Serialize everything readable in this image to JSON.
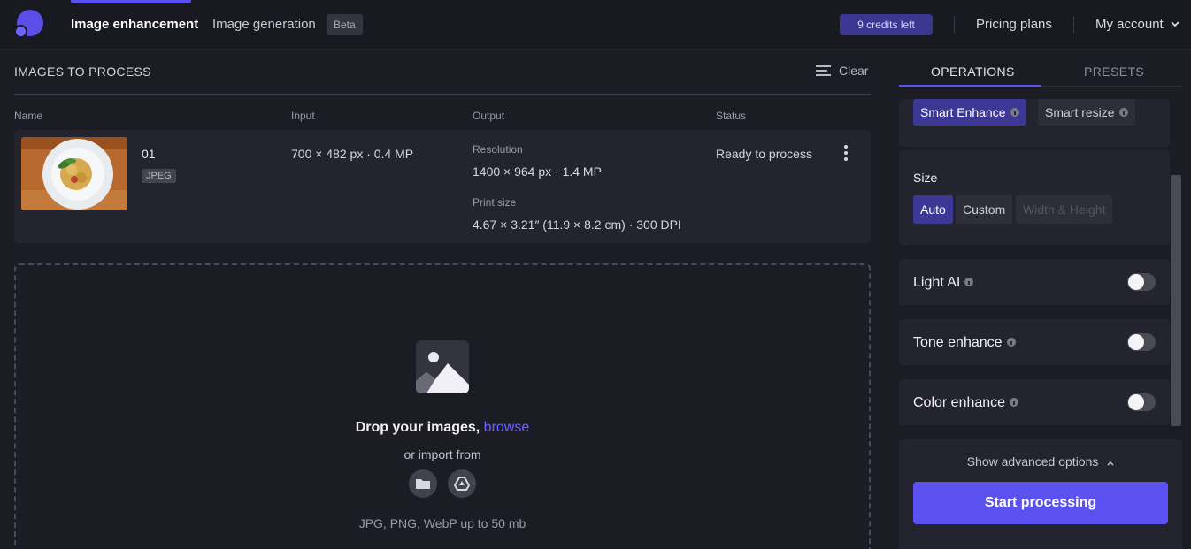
{
  "nav": {
    "items": [
      {
        "label": "Image enhancement",
        "active": true
      },
      {
        "label": "Image generation",
        "active": false
      }
    ],
    "beta_badge": "Beta",
    "credits": "9 credits left",
    "pricing": "Pricing plans",
    "account": "My account"
  },
  "main": {
    "title": "IMAGES TO PROCESS",
    "clear_label": "Clear",
    "columns": {
      "name": "Name",
      "input": "Input",
      "output": "Output",
      "status": "Status"
    },
    "rows": [
      {
        "name": "01",
        "format": "JPEG",
        "input": "700 × 482 px · 0.4 MP",
        "resolution_label": "Resolution",
        "resolution": "1400 × 964 px · 1.4 MP",
        "print_label": "Print size",
        "print_size": "4.67 × 3.21″ (11.9 × 8.2 cm) · 300 DPI",
        "status": "Ready to process"
      }
    ],
    "dropzone": {
      "main": "Drop your images,",
      "browse": "browse",
      "import": "or import from",
      "formats": "JPG, PNG, WebP up to 50 mb"
    }
  },
  "panel": {
    "tabs": [
      {
        "label": "OPERATIONS",
        "active": true
      },
      {
        "label": "PRESETS",
        "active": false
      }
    ],
    "modes": [
      {
        "label": "Smart Enhance",
        "active": true
      },
      {
        "label": "Smart resize",
        "active": false
      }
    ],
    "size": {
      "title": "Size",
      "options": [
        {
          "label": "Auto",
          "state": "on"
        },
        {
          "label": "Custom",
          "state": "off"
        },
        {
          "label": "Width & Height",
          "state": "disabled"
        }
      ]
    },
    "toggles": [
      {
        "label": "Light AI",
        "on": false
      },
      {
        "label": "Tone enhance",
        "on": false
      },
      {
        "label": "Color enhance",
        "on": false
      }
    ],
    "advanced": "Show advanced options",
    "start": "Start processing"
  },
  "colors": {
    "accent": "#5b51f0",
    "accent_dark": "#3d3896",
    "background": "#1c1c25",
    "card": "#24242e"
  },
  "icons": [
    "logo",
    "menu-lines-icon",
    "kebab-icon",
    "image-placeholder-icon",
    "folder-icon",
    "google-drive-icon",
    "info-icon",
    "chevron-down-icon",
    "chevron-up-icon"
  ]
}
